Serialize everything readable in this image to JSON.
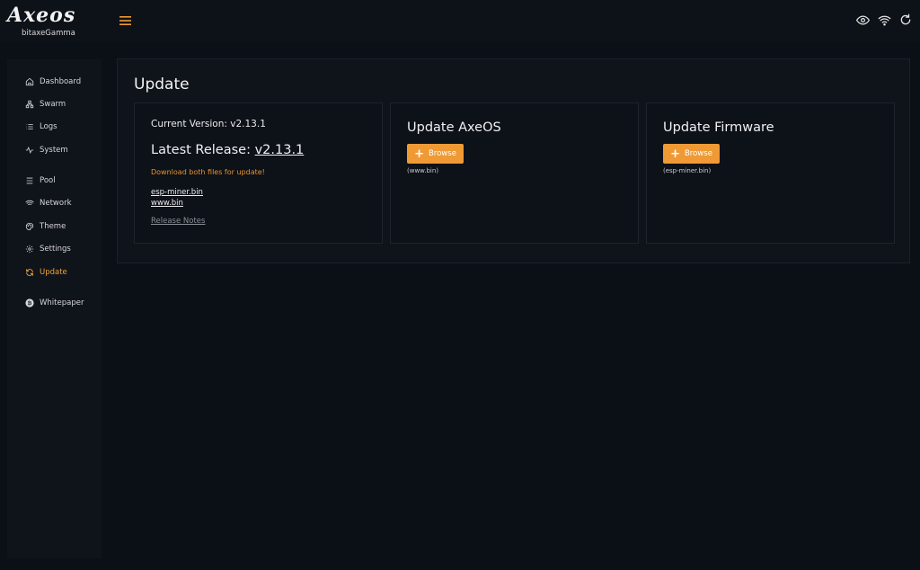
{
  "brand": {
    "logo": "Axeos",
    "device": "bitaxeGamma"
  },
  "colors": {
    "accent": "#ef9a35",
    "background": "#0b0f16",
    "panel": "#0f131a"
  },
  "topbar": {
    "icons": [
      "eye-icon",
      "wifi-icon",
      "refresh-icon"
    ]
  },
  "sidebar": {
    "items": [
      {
        "label": "Dashboard",
        "icon": "home-icon"
      },
      {
        "label": "Swarm",
        "icon": "swarm-icon"
      },
      {
        "label": "Logs",
        "icon": "list-icon"
      },
      {
        "label": "System",
        "icon": "pulse-icon"
      },
      {
        "label": "Pool",
        "icon": "pool-icon"
      },
      {
        "label": "Network",
        "icon": "wifi-icon"
      },
      {
        "label": "Theme",
        "icon": "palette-icon"
      },
      {
        "label": "Settings",
        "icon": "gear-icon"
      },
      {
        "label": "Update",
        "icon": "sync-icon",
        "active": true
      },
      {
        "label": "Whitepaper",
        "icon": "bitcoin-icon"
      }
    ]
  },
  "page": {
    "title": "Update",
    "version_card": {
      "current_version": "Current Version: v2.13.1",
      "latest_prefix": "Latest Release: ",
      "latest_version": "v2.13.1",
      "download_note": "Download both files for update!",
      "files": [
        "esp-miner.bin",
        "www.bin"
      ],
      "release_notes": "Release Notes"
    },
    "axeos_card": {
      "title": "Update AxeOS",
      "button": "Browse",
      "hint": "(www.bin)"
    },
    "firmware_card": {
      "title": "Update Firmware",
      "button": "Browse",
      "hint": "(esp-miner.bin)"
    }
  }
}
